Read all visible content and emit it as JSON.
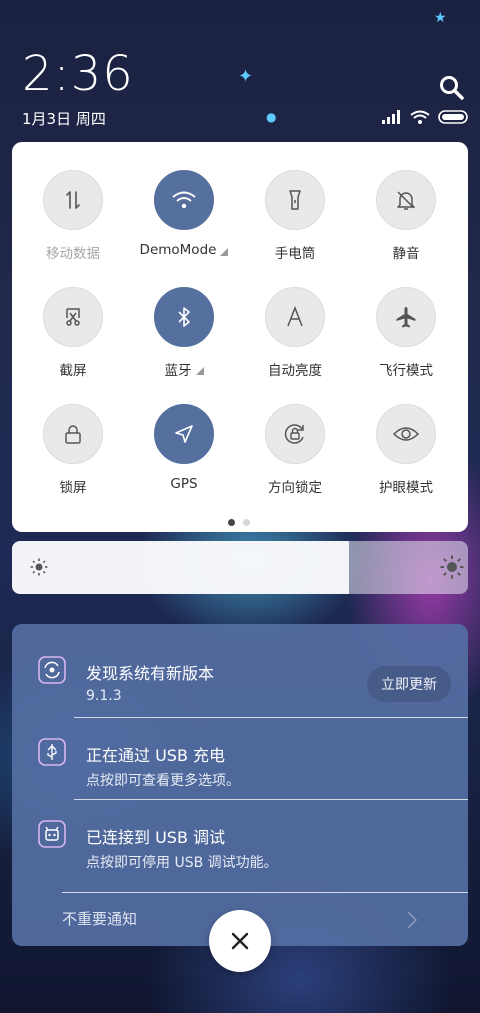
{
  "status_bar": {
    "time": "2:36",
    "date": "1月3日 周四"
  },
  "quick_settings": {
    "tiles": [
      {
        "label": "移动数据",
        "icon": "mobile-data-icon",
        "active": false,
        "dim": true
      },
      {
        "label": "DemoMode",
        "icon": "wifi-icon",
        "active": true,
        "has_more": true
      },
      {
        "label": "手电筒",
        "icon": "flashlight-icon",
        "active": false
      },
      {
        "label": "静音",
        "icon": "bell-off-icon",
        "active": false
      },
      {
        "label": "截屏",
        "icon": "screenshot-icon",
        "active": false
      },
      {
        "label": "蓝牙",
        "icon": "bluetooth-icon",
        "active": true,
        "has_more": true
      },
      {
        "label": "自动亮度",
        "icon": "auto-brightness-icon",
        "active": false
      },
      {
        "label": "飞行模式",
        "icon": "airplane-icon",
        "active": false
      },
      {
        "label": "锁屏",
        "icon": "lock-icon",
        "active": false
      },
      {
        "label": "GPS",
        "icon": "location-arrow-icon",
        "active": true
      },
      {
        "label": "方向锁定",
        "icon": "rotation-lock-icon",
        "active": false
      },
      {
        "label": "护眼模式",
        "icon": "eye-icon",
        "active": false
      }
    ],
    "page_count": 2,
    "current_page": 1
  },
  "brightness": {
    "level": 0.74
  },
  "notifications": [
    {
      "title": "发现系统有新版本",
      "subtitle": "9.1.3",
      "action": "立即更新",
      "icon": "system-update-icon"
    },
    {
      "title": "正在通过 USB 充电",
      "subtitle": "点按即可查看更多选项。",
      "icon": "usb-icon"
    },
    {
      "title": "已连接到 USB 调试",
      "subtitle": "点按即可停用 USB 调试功能。",
      "icon": "android-debug-icon"
    }
  ],
  "unimportant_label": "不重要通知",
  "colors": {
    "accent": "#55709f",
    "notification_bg": "#546ea3"
  }
}
